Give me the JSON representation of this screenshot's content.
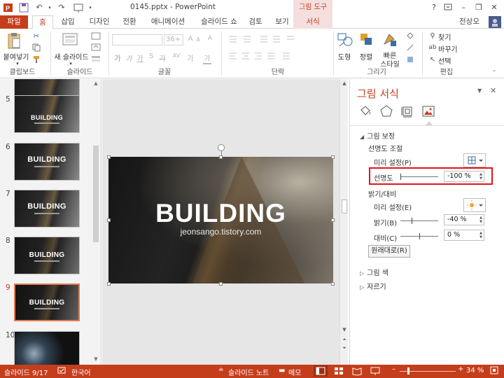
{
  "window": {
    "title": "0145.pptx - PowerPoint",
    "context_group": "그림 도구",
    "icons": [
      "powerpoint-logo-icon",
      "save-icon",
      "undo-icon",
      "redo-icon",
      "slideshow-icon",
      "help-icon",
      "ribbon-display-icon",
      "minimize-icon",
      "restore-icon",
      "close-icon"
    ]
  },
  "tabs": {
    "file": "파일",
    "home": "홈",
    "insert": "삽입",
    "design": "디자인",
    "transitions": "전환",
    "animations": "애니메이션",
    "slideshow": "슬라이드 쇼",
    "review": "검토",
    "view": "보기",
    "format": "서식",
    "user": "전상오"
  },
  "ribbon": {
    "clipboard": {
      "paste": "붙여넣기",
      "label": "클립보드"
    },
    "slides": {
      "new_slide": "새 슬라이드",
      "label": "슬라이드"
    },
    "font": {
      "size": "36+",
      "label": "글꼴",
      "bold": "가",
      "italic": "가",
      "underline": "가",
      "strike": "가",
      "shadow": "S",
      "spacing": "AV",
      "case": "가",
      "color": "가"
    },
    "paragraph": {
      "label": "단락"
    },
    "drawing": {
      "shapes": "도형",
      "arrange": "정렬",
      "quick_styles_1": "빠른",
      "quick_styles_2": "스타일",
      "label": "그리기"
    },
    "editing": {
      "find": "찾기",
      "replace": "바꾸기",
      "select": "선택",
      "label": "편집"
    }
  },
  "slides": [
    {
      "num": "5",
      "title": "BUILDING"
    },
    {
      "num": "6",
      "title": "BUILDING"
    },
    {
      "num": "7",
      "title": "BUILDING"
    },
    {
      "num": "8",
      "title": "BUILDING"
    },
    {
      "num": "9",
      "title": "BUILDING"
    },
    {
      "num": "10",
      "title": ""
    }
  ],
  "current_slide": {
    "title": "BUILDING",
    "subtitle": "jeonsango.tistory.com"
  },
  "pane": {
    "title": "그림 서식",
    "tab_icons": [
      "fill-line-icon",
      "effects-pentagon-icon",
      "size-properties-icon",
      "picture-icon"
    ],
    "section_correction": "그림 보정",
    "sharpen_soften": "선명도 조절",
    "presets_label": "미리 설정(P)",
    "sharpness_label": "선명도",
    "sharpness_value": "-100 %",
    "sharpness_level": -100,
    "brightness_contrast": "밝기/대비",
    "presets_label_2": "미리 설정(E)",
    "brightness_label": "밝기(B)",
    "brightness_value": "-40 %",
    "brightness_level": -40,
    "contrast_label": "대비(C)",
    "contrast_value": "0 %",
    "contrast_level": 0,
    "reset": "원래대로(R)",
    "section_color": "그림 색",
    "section_crop": "자르기"
  },
  "status": {
    "slide": "슬라이드 9/17",
    "lang": "한국어",
    "notes": "슬라이드 노트",
    "comments": "메모",
    "zoom": "34 %",
    "zoom_level": 34
  },
  "colors": {
    "accent": "#c43e1c",
    "highlight": "#e0141e"
  }
}
